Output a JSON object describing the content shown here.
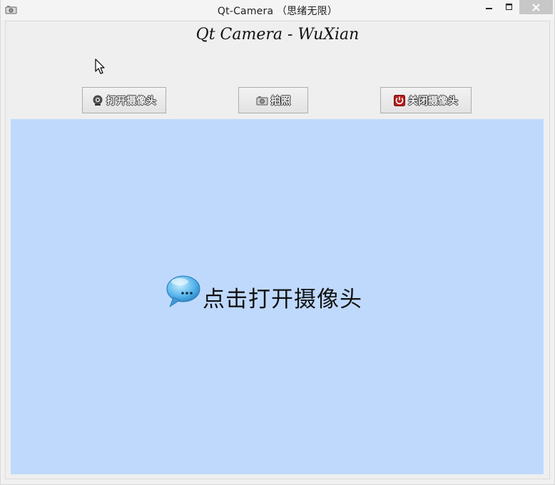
{
  "window": {
    "title": "Qt-Camera （思绪无限）"
  },
  "header": {
    "title": "Qt Camera - WuXian"
  },
  "toolbar": {
    "open_label": "打开摄像头",
    "snap_label": "拍照",
    "close_label": "关闭摄像头"
  },
  "view": {
    "message": "点击打开摄像头",
    "background": "#bfd9fd"
  },
  "icons": {
    "title": "camera-icon",
    "open": "webcam-icon",
    "snap": "camera-icon",
    "close": "power-icon",
    "message": "speech-bubble-icon"
  }
}
